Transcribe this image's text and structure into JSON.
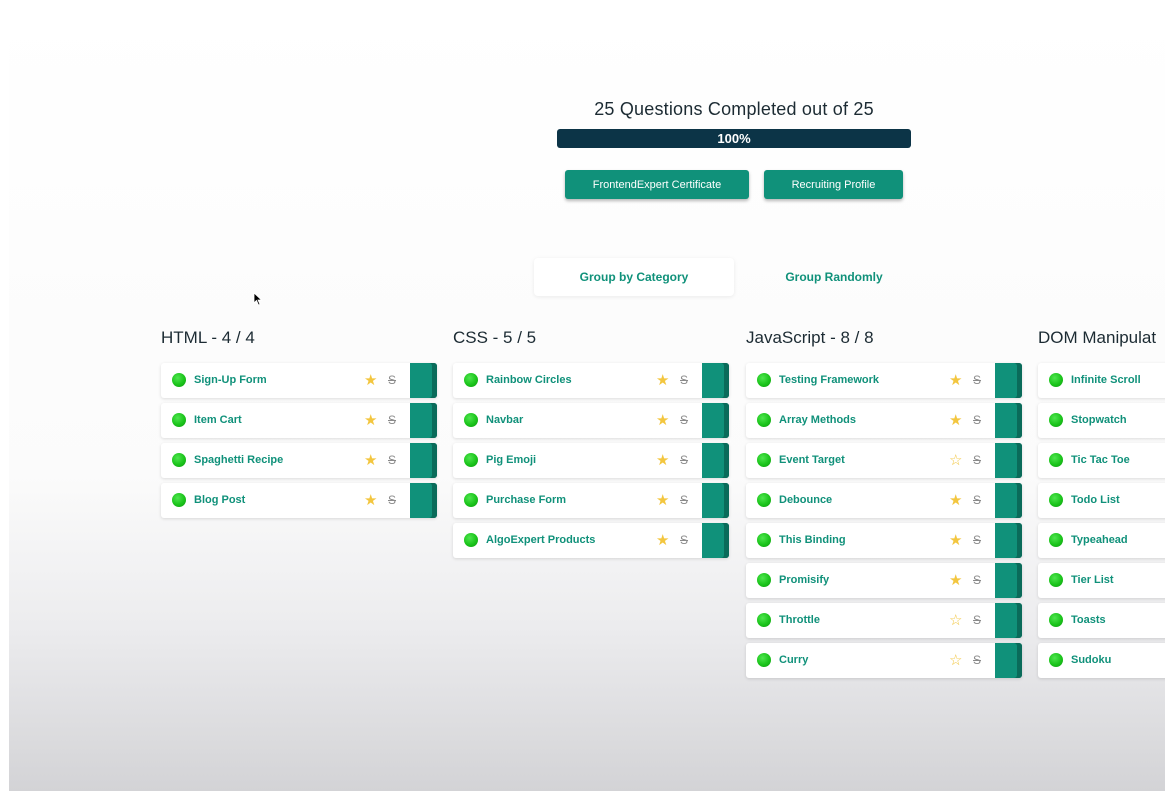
{
  "progress": {
    "title": "25 Questions Completed out of 25",
    "label": "100%",
    "fraction": 1.0
  },
  "buttons": {
    "certificate": "FrontendExpert Certificate",
    "recruiting": "Recruiting Profile"
  },
  "grouping": {
    "by_category": "Group by Category",
    "randomly": "Group Randomly",
    "active": "by_category"
  },
  "columns": [
    {
      "title": "HTML - 4 / 4",
      "items": [
        {
          "name": "Sign-Up Form",
          "starred": true
        },
        {
          "name": "Item Cart",
          "starred": true
        },
        {
          "name": "Spaghetti Recipe",
          "starred": true
        },
        {
          "name": "Blog Post",
          "starred": true
        }
      ]
    },
    {
      "title": "CSS - 5 / 5",
      "items": [
        {
          "name": "Rainbow Circles",
          "starred": true
        },
        {
          "name": "Navbar",
          "starred": true
        },
        {
          "name": "Pig Emoji",
          "starred": true
        },
        {
          "name": "Purchase Form",
          "starred": true
        },
        {
          "name": "AlgoExpert Products",
          "starred": true
        }
      ]
    },
    {
      "title": "JavaScript - 8 / 8",
      "items": [
        {
          "name": "Testing Framework",
          "starred": true
        },
        {
          "name": "Array Methods",
          "starred": true
        },
        {
          "name": "Event Target",
          "starred": false
        },
        {
          "name": "Debounce",
          "starred": true
        },
        {
          "name": "This Binding",
          "starred": true
        },
        {
          "name": "Promisify",
          "starred": true
        },
        {
          "name": "Throttle",
          "starred": false
        },
        {
          "name": "Curry",
          "starred": false
        }
      ]
    },
    {
      "title": "DOM Manipulat",
      "items": [
        {
          "name": "Infinite Scroll",
          "starred": null
        },
        {
          "name": "Stopwatch",
          "starred": null
        },
        {
          "name": "Tic Tac Toe",
          "starred": null
        },
        {
          "name": "Todo List",
          "starred": null
        },
        {
          "name": "Typeahead",
          "starred": null
        },
        {
          "name": "Tier List",
          "starred": null
        },
        {
          "name": "Toasts",
          "starred": null
        },
        {
          "name": "Sudoku",
          "starred": null
        }
      ]
    }
  ],
  "icons": {
    "completed": "green-dot-icon",
    "star": "star-icon",
    "strikethrough": "strikethrough-icon",
    "cursor": "mouse-pointer-icon"
  },
  "colors": {
    "accent": "#10917a",
    "progress": "#0c3447",
    "star": "#f3c63f",
    "complete": "#1bc41b"
  }
}
